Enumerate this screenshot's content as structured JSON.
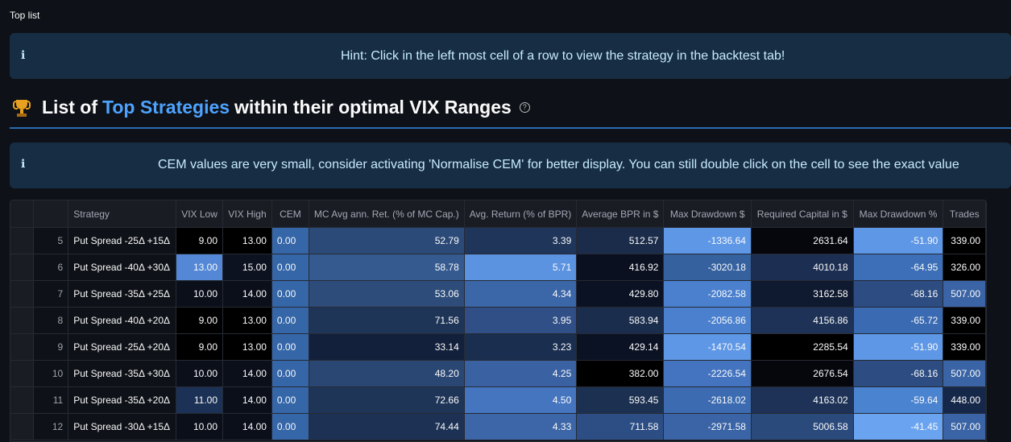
{
  "page": {
    "top_label": "Top list"
  },
  "hint": {
    "icon": "info-icon",
    "text": "Hint: Click in the left most cell of a row to view the strategy in the backtest tab!"
  },
  "heading": {
    "prefix": "List of",
    "highlight": "Top Strategies",
    "suffix": "within their optimal VIX Ranges",
    "icon": "trophy-icon",
    "help_icon": "help-icon"
  },
  "cem_notice": {
    "icon": "info-icon",
    "text": "CEM values are very small, consider activating 'Normalise CEM' for better display. You can still double click on the cell to see the exact value"
  },
  "table": {
    "columns": [
      "Strategy",
      "VIX Low",
      "VIX High",
      "CEM",
      "MC Avg ann. Ret. (% of MC Cap.)",
      "Avg. Return (% of BPR)",
      "Average BPR in $",
      "Max Drawdown $",
      "Required Capital in $",
      "Max Drawdown %",
      "Trades"
    ],
    "rows": [
      {
        "idx": "5",
        "strategy": "Put Spread -25Δ +15Δ",
        "vix_low": "9.00",
        "vix_high": "13.00",
        "cem": "0.00",
        "mc": "52.79",
        "avg_ret": "3.39",
        "bpr": "512.57",
        "mdd": "-1336.64",
        "req": "2631.64",
        "mddp": "-51.90",
        "trades": "339.00"
      },
      {
        "idx": "6",
        "strategy": "Put Spread -40Δ +30Δ",
        "vix_low": "13.00",
        "vix_high": "15.00",
        "cem": "0.00",
        "mc": "58.78",
        "avg_ret": "5.71",
        "bpr": "416.92",
        "mdd": "-3020.18",
        "req": "4010.18",
        "mddp": "-64.95",
        "trades": "326.00"
      },
      {
        "idx": "7",
        "strategy": "Put Spread -35Δ +25Δ",
        "vix_low": "10.00",
        "vix_high": "14.00",
        "cem": "0.00",
        "mc": "53.06",
        "avg_ret": "4.34",
        "bpr": "429.80",
        "mdd": "-2082.58",
        "req": "3162.58",
        "mddp": "-68.16",
        "trades": "507.00"
      },
      {
        "idx": "8",
        "strategy": "Put Spread -40Δ +20Δ",
        "vix_low": "9.00",
        "vix_high": "13.00",
        "cem": "0.00",
        "mc": "71.56",
        "avg_ret": "3.95",
        "bpr": "583.94",
        "mdd": "-2056.86",
        "req": "4156.86",
        "mddp": "-65.72",
        "trades": "339.00"
      },
      {
        "idx": "9",
        "strategy": "Put Spread -25Δ +20Δ",
        "vix_low": "9.00",
        "vix_high": "13.00",
        "cem": "0.00",
        "mc": "33.14",
        "avg_ret": "3.23",
        "bpr": "429.14",
        "mdd": "-1470.54",
        "req": "2285.54",
        "mddp": "-51.90",
        "trades": "339.00"
      },
      {
        "idx": "10",
        "strategy": "Put Spread -35Δ +30Δ",
        "vix_low": "10.00",
        "vix_high": "14.00",
        "cem": "0.00",
        "mc": "48.20",
        "avg_ret": "4.25",
        "bpr": "382.00",
        "mdd": "-2226.54",
        "req": "2676.54",
        "mddp": "-68.16",
        "trades": "507.00"
      },
      {
        "idx": "11",
        "strategy": "Put Spread -35Δ +20Δ",
        "vix_low": "11.00",
        "vix_high": "14.00",
        "cem": "0.00",
        "mc": "72.66",
        "avg_ret": "4.50",
        "bpr": "593.45",
        "mdd": "-2618.02",
        "req": "4163.02",
        "mddp": "-59.64",
        "trades": "448.00"
      },
      {
        "idx": "12",
        "strategy": "Put Spread -30Δ +15Δ",
        "vix_low": "10.00",
        "vix_high": "14.00",
        "cem": "0.00",
        "mc": "74.44",
        "avg_ret": "4.33",
        "bpr": "711.58",
        "mdd": "-2971.58",
        "req": "5006.58",
        "mddp": "-41.45",
        "trades": "507.00"
      }
    ],
    "cell_colors": [
      {
        "vix_low": "#000000",
        "vix_high": "#000000",
        "mc": "#2c4a78",
        "avg_ret": "#1f355a",
        "bpr": "#1b2c4a",
        "mdd": "#5d97e6",
        "req": "#05070d",
        "mddp": "#5d97e6",
        "trades": "#000000"
      },
      {
        "vix_low": "#5488d6",
        "vix_high": "#0d1220",
        "mc": "#355a8f",
        "avg_ret": "#5b93e0",
        "bpr": "#0a1020",
        "mdd": "#35619f",
        "req": "#1c2f52",
        "mddp": "#3c6fb7",
        "trades": "#000000"
      },
      {
        "vix_low": "#0a0f1a",
        "vix_high": "#0a0f1a",
        "mc": "#2d4c7a",
        "avg_ret": "#3b66a8",
        "bpr": "#0b1224",
        "mdd": "#4a80ce",
        "req": "#0f1a30",
        "mddp": "#2c4c82",
        "trades": "#3a64a5"
      },
      {
        "vix_low": "#000000",
        "vix_high": "#000000",
        "mc": "#1f3558",
        "avg_ret": "#304f86",
        "bpr": "#1a2d4d",
        "mdd": "#4a80ce",
        "req": "#1d3256",
        "mddp": "#3a6ab2",
        "trades": "#000000"
      },
      {
        "vix_low": "#000000",
        "vix_high": "#000000",
        "mc": "#13203b",
        "avg_ret": "#1a2e50",
        "bpr": "#0b1224",
        "mdd": "#5d97e6",
        "req": "#000000",
        "mddp": "#5d97e6",
        "trades": "#000000"
      },
      {
        "vix_low": "#0a0f1a",
        "vix_high": "#0a0f1a",
        "mc": "#2a4774",
        "avg_ret": "#3a62a3",
        "bpr": "#000000",
        "mdd": "#4474c0",
        "req": "#05070d",
        "mddp": "#2c4c82",
        "trades": "#3a64a5"
      },
      {
        "vix_low": "#1c3156",
        "vix_high": "#0a0f1a",
        "mc": "#1f3558",
        "avg_ret": "#4675c0",
        "bpr": "#1c3051",
        "mdd": "#3c6bb1",
        "req": "#1d3256",
        "mddp": "#4a83d0",
        "trades": "#16284a"
      },
      {
        "vix_low": "#0a0f1a",
        "vix_high": "#0a0f1a",
        "mc": "#1c3154",
        "avg_ret": "#3c66a8",
        "bpr": "#2c4e85",
        "mdd": "#3a64a6",
        "req": "#2b4a7c",
        "mddp": "#6aa4f0",
        "trades": "#3a64a5"
      }
    ]
  }
}
